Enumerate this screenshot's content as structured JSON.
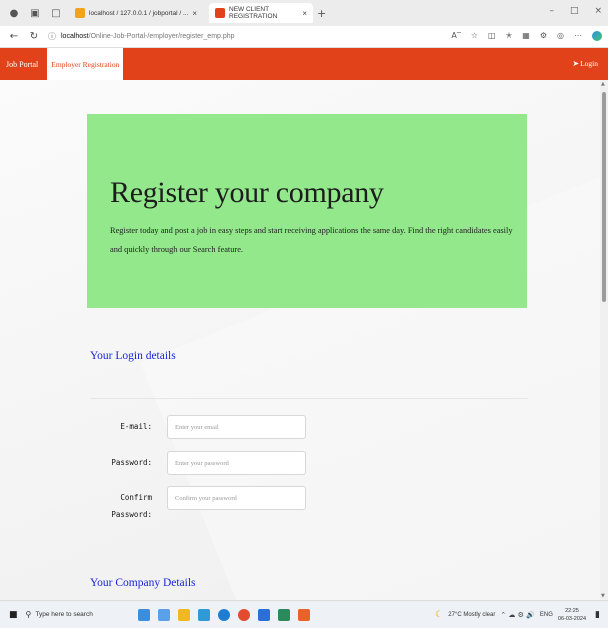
{
  "browser": {
    "tabs": [
      {
        "label": "localhost / 127.0.0.1 / jobportal / ...",
        "active": false
      },
      {
        "label": "NEW CLIENT REGISTRATION",
        "active": true
      }
    ],
    "url_host": "localhost",
    "url_path": "/Online-Job-Portal-/employer/register_emp.php"
  },
  "navbar": {
    "brand": "Job Portal",
    "tab_active": "Employer Registration",
    "login_label": "Login",
    "color": "#e2421a"
  },
  "jumbotron": {
    "title": "Register your company",
    "description": "Register today and post a job in easy steps and start receiving applications the same day. Find the right candidates easily and quickly through our Search feature.",
    "color": "#92e88b"
  },
  "login_section": {
    "heading": "Your Login details",
    "fields": [
      {
        "label": "E-mail:",
        "placeholder": "Enter your email"
      },
      {
        "label": "Password:",
        "placeholder": "Enter your password"
      },
      {
        "label": "Confirm Password:",
        "placeholder": "Confirm your password"
      }
    ]
  },
  "company_section": {
    "heading": "Your Company Details"
  },
  "taskbar": {
    "search_placeholder": "Type here to search",
    "weather": "27°C Mostly clear",
    "language": "ENG",
    "time": "22:25",
    "date": "06-03-2024"
  }
}
